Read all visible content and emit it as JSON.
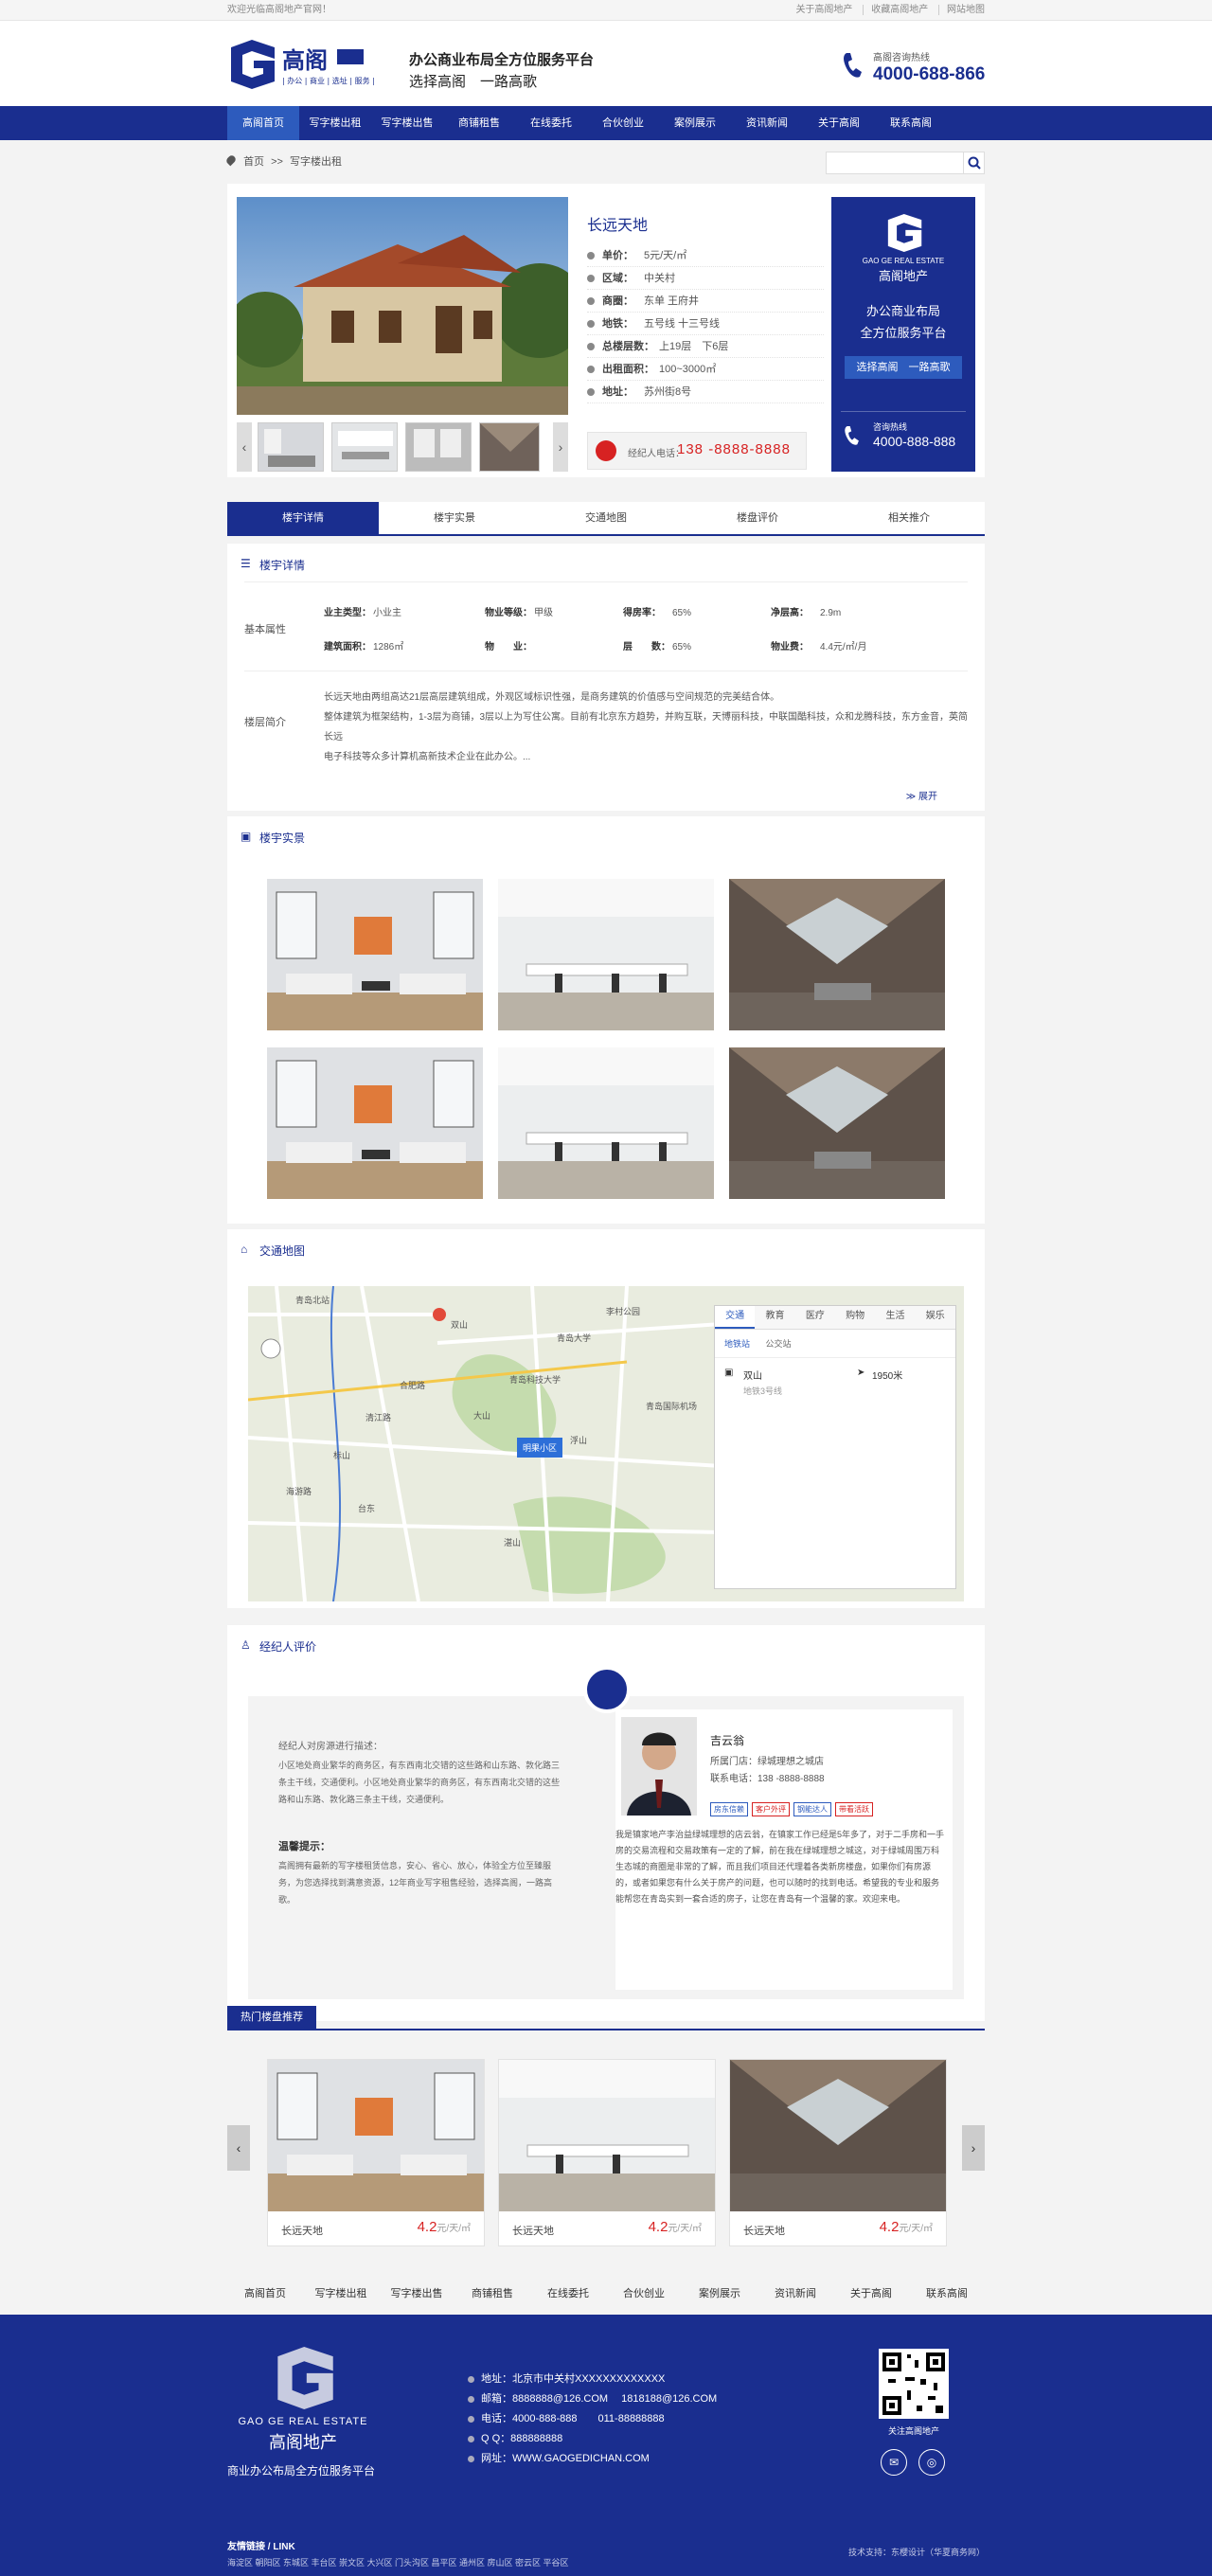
{
  "topbar": {
    "welcome": "欢迎光临高阁地产官网！",
    "links": [
      "关于高阁地产",
      "收藏高阁地产",
      "网站地图"
    ]
  },
  "header": {
    "slogan_main": "办公商业布局全方位服务平台",
    "slogan_sub": "选择高阁　一路高歌",
    "hotline_label": "高阁咨询热线",
    "hotline": "4000-688-866"
  },
  "nav": [
    "高阁首页",
    "写字楼出租",
    "写字楼出售",
    "商铺租售",
    "在线委托",
    "合伙创业",
    "案例展示",
    "资讯新闻",
    "关于高阁",
    "联系高阁"
  ],
  "breadcrumb": {
    "home": "首页",
    "sep": ">>",
    "current": "写字楼出租"
  },
  "property": {
    "title": "长远天地",
    "rows": [
      {
        "k": "单价：",
        "v": "5元/天/㎡"
      },
      {
        "k": "区域：",
        "v": "中关村"
      },
      {
        "k": "商圈：",
        "v": "东单  王府井"
      },
      {
        "k": "地铁：",
        "v": "五号线  十三号线"
      },
      {
        "k": "总楼层数：",
        "v": "上19层　下6层"
      },
      {
        "k": "出租面积：",
        "v": "100~3000㎡"
      },
      {
        "k": "地址：",
        "v": "苏州街8号"
      }
    ],
    "agent_label": "经纪人电话：",
    "agent_phone": "138 -8888-8888"
  },
  "ad": {
    "en": "GAO GE REAL ESTATE",
    "cn": "高阁地产",
    "line1": "办公商业布局",
    "line2": "全方位服务平台",
    "button": "选择高阁　一路高歌",
    "hot_label": "咨询热线",
    "hot": "4000-888-888"
  },
  "tabs": [
    "楼宇详情",
    "楼宇实景",
    "交通地图",
    "楼盘评价",
    "相关推介"
  ],
  "detail": {
    "title": "楼宇详情",
    "attr_label": "基本属性",
    "intro_label": "楼层简介",
    "row1": [
      {
        "k": "业主类型：",
        "v": "小业主"
      },
      {
        "k": "物业等级：",
        "v": "甲级"
      },
      {
        "k": "得房率：",
        "v": "65%"
      },
      {
        "k": "净层高：",
        "v": "2.9m"
      }
    ],
    "row2": [
      {
        "k": "建筑面积：",
        "v": "1286㎡"
      },
      {
        "k": "物　　业：",
        "v": ""
      },
      {
        "k": "层　　数：",
        "v": "65%"
      },
      {
        "k": "物业费：",
        "v": "4.4元/㎡/月"
      }
    ],
    "para": [
      "长远天地由两组高达21层高层建筑组成，外观区域标识性强，是商务建筑的价值感与空间规范的完美结合体。",
      "整体建筑为框架结构，1-3层为商铺，3层以上为写住公寓。目前有北京东方趋势，并购互联，天博丽科技，中联国酷科技，众和龙腾科技，东方金音，英简长远",
      "电子科技等众多计算机高新技术企业在此办公。..."
    ],
    "more": "展开"
  },
  "photos": {
    "title": "楼宇实景"
  },
  "map": {
    "title": "交通地图",
    "tabs": [
      "交通",
      "教育",
      "医疗",
      "购物",
      "生活",
      "娱乐"
    ],
    "subtabs": [
      "地铁站",
      "公交站"
    ],
    "station": "双山",
    "distance": "1950米",
    "line": "地铁3号线",
    "marker": "明果小区",
    "places": [
      "青岛北站",
      "双山",
      "青岛大学",
      "合肥路",
      "大山",
      "清江路",
      "标山",
      "浮山",
      "海游路",
      "台东",
      "李村公园",
      "青岛科技大学",
      "湛山",
      "青岛国际机场"
    ]
  },
  "review": {
    "title": "经纪人评价",
    "q_label": "经纪人对房源进行描述：",
    "q_text": "小区地处商业繁华的商务区，有东西南北交错的这些路和山东路、敦化路三条主干线，交通便利。小区地处商业繁华的商务区，有东西南北交错的这些路和山东路、敦化路三条主干线，交通便利。",
    "tip_label": "温馨提示：",
    "tip_text": "高阁拥有最新的写字楼租赁信息，安心、省心、放心，体验全方位至臻服务，为您选择找到满意资源，12年商业写字租售经验，选择高阁，一路高歌。",
    "name": "吉云翁",
    "store": "所属门店：绿城理想之城店",
    "phone": "联系电话：138 -8888-8888",
    "tags": [
      "房东信赖",
      "客户外评",
      "钢能达人",
      "带看活跃"
    ],
    "bio": "我是镇家地产李治益绿城理想的店云翁，在镇家工作已经是5年多了，对于二手房和一手房的交易流程和交易政策有一定的了解，前在我在绿城理想之城这，对于绿城周围万科生态城的商圈是非常的了解，而且我们项目还代理着各类新房楼盘，如果你们有房源的，或者如果您有什么关于房产的问题，也可以随时的找到电话。希望我的专业和服务能帮您在青岛实到一套合适的房子，让您在青岛有一个温馨的家。欢迎来电。"
  },
  "hot": {
    "title": "热门楼盘推荐",
    "items": [
      {
        "name": "长远天地",
        "price": "4.2",
        "unit": "元/天/㎡"
      },
      {
        "name": "长远天地",
        "price": "4.2",
        "unit": "元/天/㎡"
      },
      {
        "name": "长远天地",
        "price": "4.2",
        "unit": "元/天/㎡"
      }
    ]
  },
  "footnav": [
    "高阁首页",
    "写字楼出租",
    "写字楼出售",
    "商铺租售",
    "在线委托",
    "合伙创业",
    "案例展示",
    "资讯新闻",
    "关于高阁",
    "联系高阁"
  ],
  "footer": {
    "en": "GAO GE REAL ESTATE",
    "cn": "高阁地产",
    "slogan": "商业办公布局全方位服务平台",
    "contacts": [
      "地址：北京市中关村XXXXXXXXXXXXX",
      "邮箱：8888888@126.COM　 1818188@126.COM",
      "电话：4000-888-888　　011-88888888",
      "Q Q：888888888",
      "网址：WWW.GAOGEDICHAN.COM"
    ],
    "qr_label": "关注高阁地产",
    "links_title": "友情链接 / LINK",
    "links": "海淀区 朝阳区 东城区 丰台区 崇文区 大兴区 门头沟区 昌平区 通州区 房山区 密云区 平谷区",
    "support": "技术支持：东櫻设计（华夏商务网）"
  }
}
